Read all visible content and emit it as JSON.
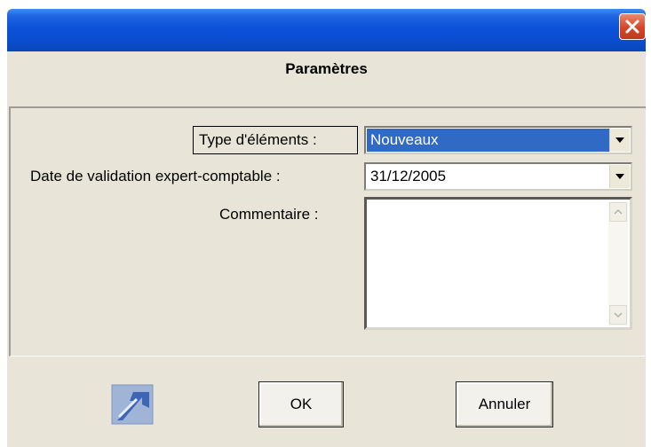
{
  "dialog": {
    "title": "Paramètres"
  },
  "form": {
    "type_label": "Type d'éléments :",
    "type_value": "Nouveaux",
    "date_label": "Date de validation expert-comptable :",
    "date_value": "31/12/2005",
    "comment_label": "Commentaire :",
    "comment_value": ""
  },
  "buttons": {
    "ok_label": "OK",
    "cancel_label": "Annuler"
  },
  "icons": {
    "close": "close-icon",
    "dropdown": "chevron-down-icon",
    "app": "arrow-shortcut-icon"
  },
  "colors": {
    "titlebar": "#0b52d9",
    "close": "#d5452a",
    "selection": "#316ac5",
    "dialog_bg": "#e8e5d8"
  }
}
